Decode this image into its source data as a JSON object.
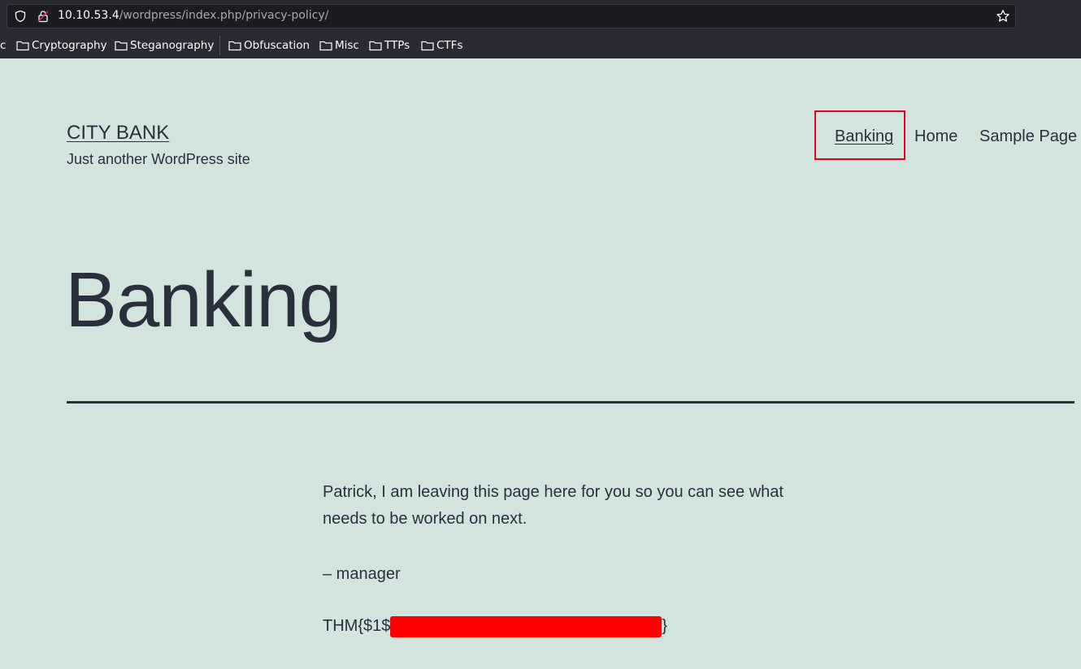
{
  "browser": {
    "url_host": "10.10.53.4",
    "url_path": "/wordpress/index.php/privacy-policy/",
    "bookmarks": [
      {
        "label": "c"
      },
      {
        "label": "Cryptography"
      },
      {
        "label": "Steganography"
      },
      {
        "label": "Obfuscation"
      },
      {
        "label": "Misc"
      },
      {
        "label": "TTPs"
      },
      {
        "label": "CTFs"
      }
    ]
  },
  "site": {
    "title": "CITY BANK",
    "tagline": "Just another WordPress site"
  },
  "nav": {
    "items": [
      {
        "label": "Banking"
      },
      {
        "label": "Home"
      },
      {
        "label": "Sample Page"
      }
    ],
    "highlight_color": "#e5001a"
  },
  "page": {
    "title": "Banking",
    "paragraphs": [
      "Patrick, I am leaving this page here for you so you can see what needs to be worked on next.",
      "– manager"
    ],
    "flag_prefix": "THM{$1$",
    "flag_suffix": "}",
    "redaction_color": "#ff0000"
  },
  "colors": {
    "page_background": "#d1e4dd",
    "text": "#28303d",
    "chrome_background": "#2b2a33"
  }
}
